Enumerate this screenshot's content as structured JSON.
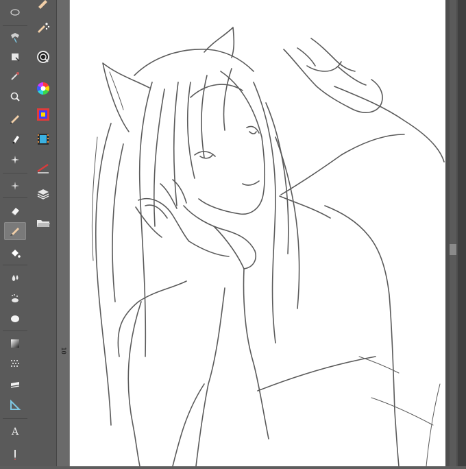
{
  "app": {
    "accent": "#7a7a7a",
    "canvas_color": "#ffffff",
    "line_color": "#555555"
  },
  "toolbar": {
    "tools": [
      {
        "icon": "lasso-icon",
        "glyph": "◌"
      },
      {
        "icon": "move-icon",
        "glyph": "✥"
      },
      {
        "icon": "box-icon",
        "glyph": "▣"
      },
      {
        "icon": "eyedropper-icon",
        "glyph": "✎"
      },
      {
        "icon": "zoom-icon",
        "glyph": "⊙"
      },
      {
        "icon": "pen-icon",
        "glyph": "✐"
      },
      {
        "icon": "marker-icon",
        "glyph": "✒"
      },
      {
        "icon": "sparkle-icon",
        "glyph": "✲"
      },
      {
        "icon": "transform-icon",
        "glyph": "✛"
      },
      {
        "icon": "eraser-icon",
        "glyph": "▰"
      },
      {
        "icon": "brush-icon",
        "glyph": "✍"
      },
      {
        "icon": "fill-icon",
        "glyph": "▼"
      },
      {
        "icon": "blend-icon",
        "glyph": "●"
      },
      {
        "icon": "airbrush-icon",
        "glyph": "✇"
      },
      {
        "icon": "balloon-icon",
        "glyph": "◯"
      },
      {
        "icon": "gradient-icon",
        "glyph": "◩"
      },
      {
        "icon": "pattern-icon",
        "glyph": "▦"
      },
      {
        "icon": "line-icon",
        "glyph": "▬"
      },
      {
        "icon": "ruler-icon",
        "glyph": "◺"
      },
      {
        "icon": "text-icon",
        "glyph": "A"
      },
      {
        "icon": "pencil-icon",
        "glyph": "╿"
      }
    ],
    "active_index": 10
  },
  "subtools": [
    {
      "icon": "pen-settings-icon"
    },
    {
      "icon": "brush-settings-icon"
    },
    {
      "icon": "navigator-icon"
    },
    {
      "icon": "color-wheel-icon"
    },
    {
      "icon": "color-set-icon"
    },
    {
      "icon": "animation-icon"
    },
    {
      "icon": "vector-icon"
    },
    {
      "icon": "layer-icon"
    },
    {
      "icon": "folder-icon"
    }
  ],
  "ruler": {
    "mark_label": "10"
  }
}
